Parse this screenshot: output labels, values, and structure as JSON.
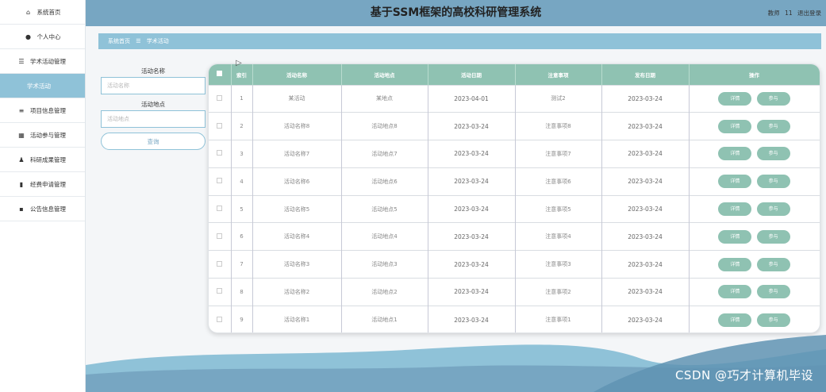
{
  "header": {
    "title": "基于SSM框架的高校科研管理系统",
    "user_role": "教师",
    "user_name": "11",
    "logout_label": "退出登录"
  },
  "sidebar": {
    "items": [
      {
        "label": "系统首页",
        "icon": "home-icon"
      },
      {
        "label": "个人中心",
        "icon": "user-icon"
      },
      {
        "label": "学术活动管理",
        "icon": "list-icon"
      },
      {
        "label": "学术活动",
        "icon": "",
        "active": true
      },
      {
        "label": "项目信息管理",
        "icon": "menu-icon"
      },
      {
        "label": "活动参与管理",
        "icon": "grid-icon"
      },
      {
        "label": "科研成果管理",
        "icon": "person-icon"
      },
      {
        "label": "经费申请管理",
        "icon": "bar-chart-icon"
      },
      {
        "label": "公告信息管理",
        "icon": "blocks-icon"
      }
    ]
  },
  "breadcrumb": {
    "home": "系统首页",
    "separator": "☰",
    "current": "学术活动"
  },
  "search": {
    "name_label": "活动名称",
    "name_placeholder": "活动名称",
    "place_label": "活动地点",
    "place_placeholder": "活动地点",
    "button_label": "查询"
  },
  "table": {
    "headers": [
      "索引",
      "活动名称",
      "活动地点",
      "活动日期",
      "注意事项",
      "发布日期",
      "操作"
    ],
    "detail_label": "详情",
    "join_label": "参与",
    "rows": [
      {
        "index": "1",
        "name": "某活动",
        "place": "某地点",
        "date": "2023-04-01",
        "note": "测试2",
        "publish": "2023-03-24"
      },
      {
        "index": "2",
        "name": "活动名称8",
        "place": "活动地点8",
        "date": "2023-03-24",
        "note": "注意事项8",
        "publish": "2023-03-24"
      },
      {
        "index": "3",
        "name": "活动名称7",
        "place": "活动地点7",
        "date": "2023-03-24",
        "note": "注意事项7",
        "publish": "2023-03-24"
      },
      {
        "index": "4",
        "name": "活动名称6",
        "place": "活动地点6",
        "date": "2023-03-24",
        "note": "注意事项6",
        "publish": "2023-03-24"
      },
      {
        "index": "5",
        "name": "活动名称5",
        "place": "活动地点5",
        "date": "2023-03-24",
        "note": "注意事项5",
        "publish": "2023-03-24"
      },
      {
        "index": "6",
        "name": "活动名称4",
        "place": "活动地点4",
        "date": "2023-03-24",
        "note": "注意事项4",
        "publish": "2023-03-24"
      },
      {
        "index": "7",
        "name": "活动名称3",
        "place": "活动地点3",
        "date": "2023-03-24",
        "note": "注意事项3",
        "publish": "2023-03-24"
      },
      {
        "index": "8",
        "name": "活动名称2",
        "place": "活动地点2",
        "date": "2023-03-24",
        "note": "注意事项2",
        "publish": "2023-03-24"
      },
      {
        "index": "9",
        "name": "活动名称1",
        "place": "活动地点1",
        "date": "2023-03-24",
        "note": "注意事项1",
        "publish": "2023-03-24"
      }
    ]
  },
  "watermark": "CSDN @巧才计算机毕设",
  "colors": {
    "header": "#77a6c2",
    "accent": "#8fc2d8",
    "table_header": "#8fc2b2",
    "button": "#8fc2b2"
  }
}
